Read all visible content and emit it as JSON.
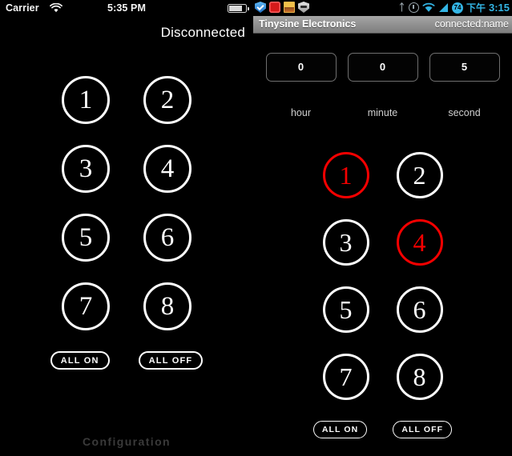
{
  "ios": {
    "status_bar": {
      "carrier": "Carrier",
      "wifi_icon": "wifi-icon",
      "time": "5:35 PM",
      "battery_icon": "battery-icon"
    },
    "connection_status": "Disconnected",
    "relays": [
      {
        "label": "1",
        "state": "off"
      },
      {
        "label": "2",
        "state": "off"
      },
      {
        "label": "3",
        "state": "off"
      },
      {
        "label": "4",
        "state": "off"
      },
      {
        "label": "5",
        "state": "off"
      },
      {
        "label": "6",
        "state": "off"
      },
      {
        "label": "7",
        "state": "off"
      },
      {
        "label": "8",
        "state": "off"
      }
    ],
    "all_on_label": "ALL ON",
    "all_off_label": "ALL OFF",
    "configuration_label": "Configuration"
  },
  "android": {
    "status_bar": {
      "left_icons": [
        "shield-blue-icon",
        "red-box-icon",
        "picture-icon",
        "shield-grey-icon"
      ],
      "bluetooth_icon": "bluetooth-icon",
      "alarm_icon": "alarm-clock-icon",
      "wifi_icon": "wifi-icon",
      "signal_icon": "cellular-signal-icon",
      "battery_level": "74",
      "am_pm": "下午",
      "time": "3:15"
    },
    "title_bar": {
      "app_title": "Tinysine Electronics",
      "connection_status": "connected:name"
    },
    "timer": {
      "fields": [
        {
          "name": "hour",
          "value": "0",
          "label": "hour"
        },
        {
          "name": "minute",
          "value": "0",
          "label": "minute"
        },
        {
          "name": "second",
          "value": "5",
          "label": "second"
        }
      ]
    },
    "relays": [
      {
        "label": "1",
        "state": "on"
      },
      {
        "label": "2",
        "state": "off"
      },
      {
        "label": "3",
        "state": "off"
      },
      {
        "label": "4",
        "state": "on"
      },
      {
        "label": "5",
        "state": "off"
      },
      {
        "label": "6",
        "state": "off"
      },
      {
        "label": "7",
        "state": "off"
      },
      {
        "label": "8",
        "state": "off"
      }
    ],
    "all_on_label": "ALL ON",
    "all_off_label": "ALL OFF"
  },
  "colors": {
    "background": "#000000",
    "relay_off": "#ffffff",
    "relay_on": "#f50000",
    "android_accent": "#33b5e5",
    "titlebar_gray": "#8f8f8f",
    "config_gray": "#3a3a3a"
  }
}
